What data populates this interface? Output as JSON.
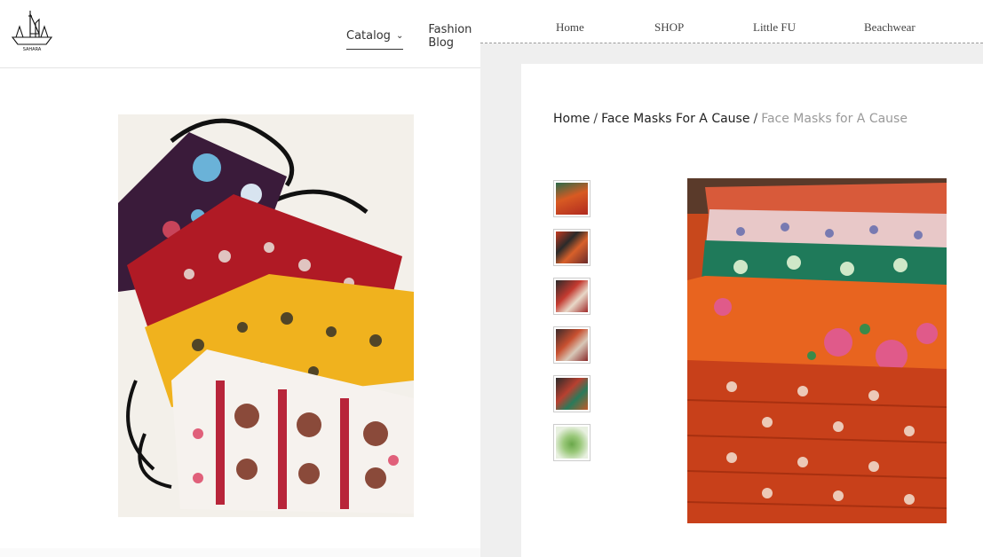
{
  "logo": {
    "text": "SAHARA",
    "icon": "boat-skyline-logo"
  },
  "left_nav": {
    "catalog_label": "Catalog",
    "catalog_chevron": "chevron-down-icon",
    "blog_label": "Fashion Blog"
  },
  "right_nav": {
    "items": [
      "Home",
      "SHOP",
      "Little FU",
      "Beachwear"
    ]
  },
  "breadcrumb": {
    "home": "Home",
    "separator": "/",
    "category": "Face Masks For A Cause",
    "current": "Face Masks for A Cause"
  },
  "colors": {
    "breadcrumb_current": "#999999",
    "pane_divider_bg": "#efefef",
    "mask_orange": "#e8641f",
    "mask_red": "#b01a25",
    "mask_yellow": "#f0b21e",
    "mask_purple": "#3a1b3a",
    "mask_teal": "#1f7a5a"
  },
  "product": {
    "thumbnail_count": 6
  }
}
